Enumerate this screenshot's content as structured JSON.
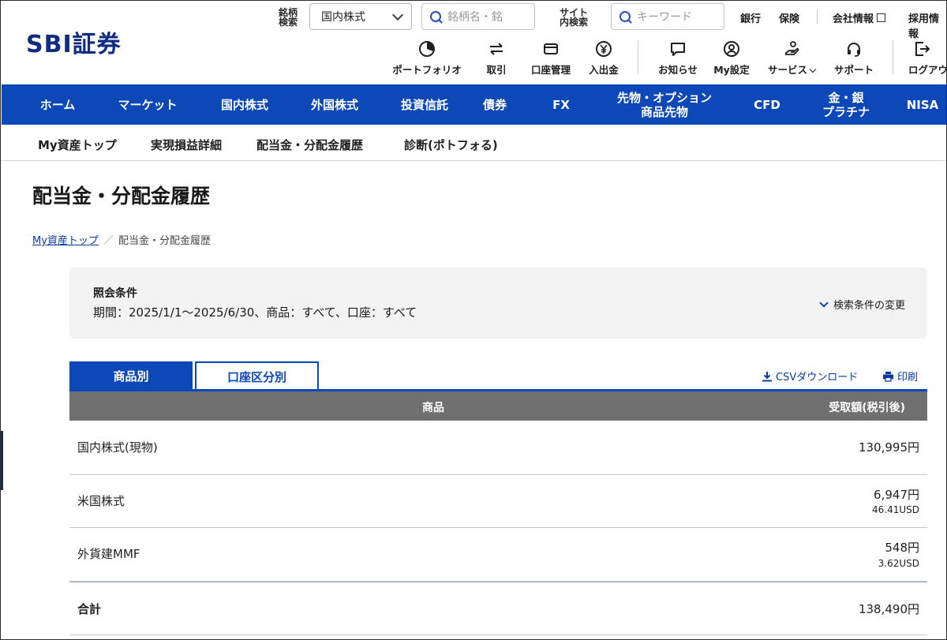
{
  "header": {
    "logo": "SBI証券",
    "brand_color": "#0d48b8",
    "symbol_search_label_1": "銘柄",
    "symbol_search_label_2": "検索",
    "market_select_value": "国内株式",
    "symbol_search_placeholder": "銘柄名・銘",
    "site_search_label_1": "サイト",
    "site_search_label_2": "内検索",
    "keyword_placeholder": "キーワード",
    "top_links": [
      "銀行",
      "保険",
      "会社情報",
      "採用情報"
    ],
    "icon_menu": [
      {
        "label": "ポートフォリオ",
        "icon": "portfolio-icon"
      },
      {
        "label": "取引",
        "icon": "trade-arrows-icon"
      },
      {
        "label": "口座管理",
        "icon": "wallet-icon"
      },
      {
        "label": "入出金",
        "icon": "yen-transfer-icon"
      },
      {
        "label": "お知らせ",
        "icon": "notification-icon"
      },
      {
        "label": "My設定",
        "icon": "user-settings-icon"
      },
      {
        "label": "サービス",
        "icon": "service-icon"
      },
      {
        "label": "サポート",
        "icon": "headset-icon"
      },
      {
        "label": "ログアウト",
        "icon": "logout-icon"
      }
    ]
  },
  "nav": {
    "items": [
      {
        "label": "ホーム"
      },
      {
        "label": "マーケット"
      },
      {
        "label": "国内株式"
      },
      {
        "label": "外国株式"
      },
      {
        "label": "投資信託"
      },
      {
        "label": "債券"
      },
      {
        "label": "FX"
      },
      {
        "line1": "先物・オプション",
        "line2": "商品先物"
      },
      {
        "label": "CFD"
      },
      {
        "line1": "金・銀",
        "line2": "プラチナ"
      },
      {
        "label": "NISA"
      }
    ]
  },
  "subnav": {
    "items": [
      "My資産トップ",
      "実現損益詳細",
      "配当金・分配金履歴",
      "診断(ポトフォる)"
    ]
  },
  "page": {
    "title": "配当金・分配金履歴",
    "breadcrumb_link": "My資産トップ",
    "breadcrumb_separator": "／",
    "breadcrumb_current": "配当金・分配金履歴"
  },
  "conditions": {
    "heading": "照会条件",
    "value": "期間：2025/1/1～2025/6/30、商品：すべて、口座：すべて",
    "change_link": "検索条件の変更"
  },
  "tabs": {
    "by_product": "商品別",
    "by_account": "口座区分別"
  },
  "tools": {
    "csv": "CSVダウンロード",
    "print": "印刷"
  },
  "table": {
    "headers": {
      "product": "商品",
      "amount": "受取額(税引後)"
    },
    "rows": [
      {
        "product": "国内株式(現物)",
        "amount": "130,995円",
        "sub": ""
      },
      {
        "product": "米国株式",
        "amount": "6,947円",
        "sub": "46.41USD"
      },
      {
        "product": "外貨建MMF",
        "amount": "548円",
        "sub": "3.62USD"
      }
    ],
    "total": {
      "label": "合計",
      "amount": "138,490円"
    }
  }
}
